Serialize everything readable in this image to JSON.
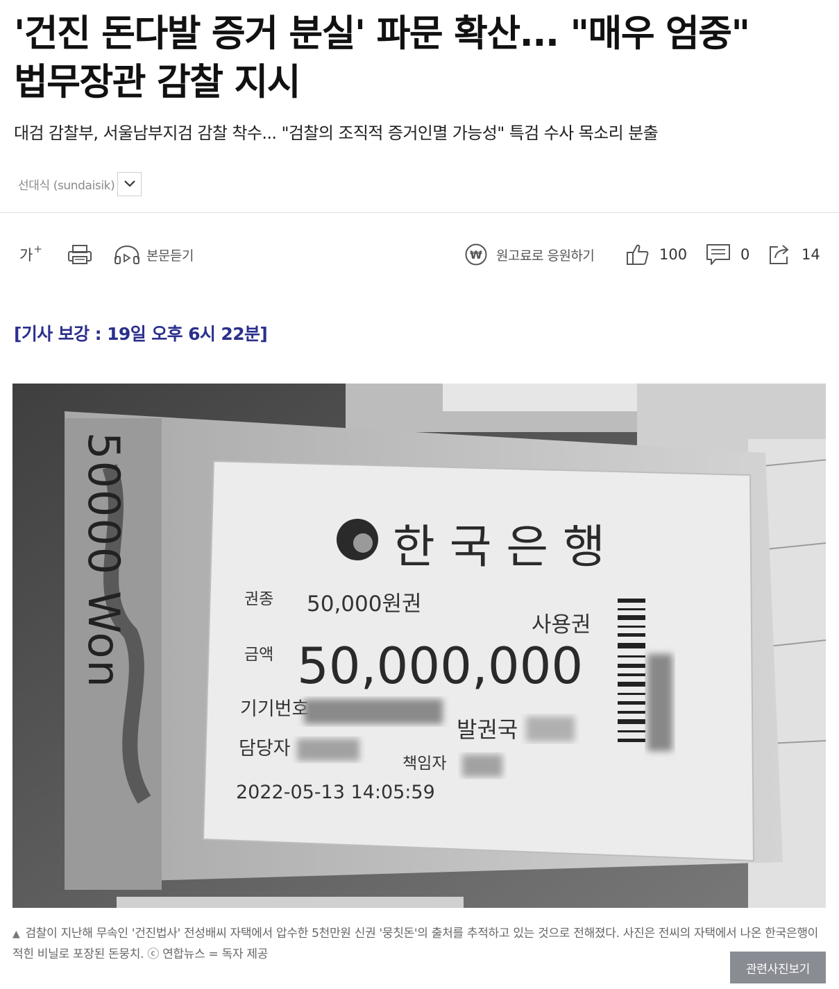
{
  "article": {
    "headline_line1": "'건진 돈다발 증거 분실' 파문 확산... \"매우 엄중\"",
    "headline_line2": "법무장관 감찰 지시",
    "subheadline": "대검 감찰부, 서울남부지검 감찰 착수... \"검찰의 조직적 증거인멸 가능성\" 특검 수사 목소리 분출",
    "author": "선대식 (sundaisik)",
    "update_note": "[기사 보강 : 19일 오후 6시 22분]"
  },
  "toolbar": {
    "font_size_label": "가",
    "font_size_suffix": "+",
    "listen_label": "본문듣기",
    "support_label": "원고료로 응원하기",
    "like_count": "100",
    "comment_count": "0",
    "share_count": "14"
  },
  "photo": {
    "bank_name": "한 국 은 행",
    "denomination_label": "권종",
    "denomination_value": "50,000원권",
    "usage_label": "사용권",
    "amount_label": "금액",
    "amount_value": "50,000,000",
    "machine_label": "기기번호",
    "issuer_label": "발권국",
    "manager_label": "담당자",
    "responsible_label": "책임자",
    "timestamp": "2022-05-13  14:05:59",
    "banknote_text": "50000 Won"
  },
  "caption": {
    "text": "검찰이 지난해 무속인 '건진법사' 전성배씨 자택에서 압수한 5천만원 신권 '뭉칫돈'의 출처를 추적하고 있는 것으로 전해졌다. 사진은 전씨의 자택에서 나온 한국은행이 적힌 비닐로 포장된 돈뭉치. ⓒ 연합뉴스 = 독자 제공",
    "related_button": "관련사진보기"
  }
}
